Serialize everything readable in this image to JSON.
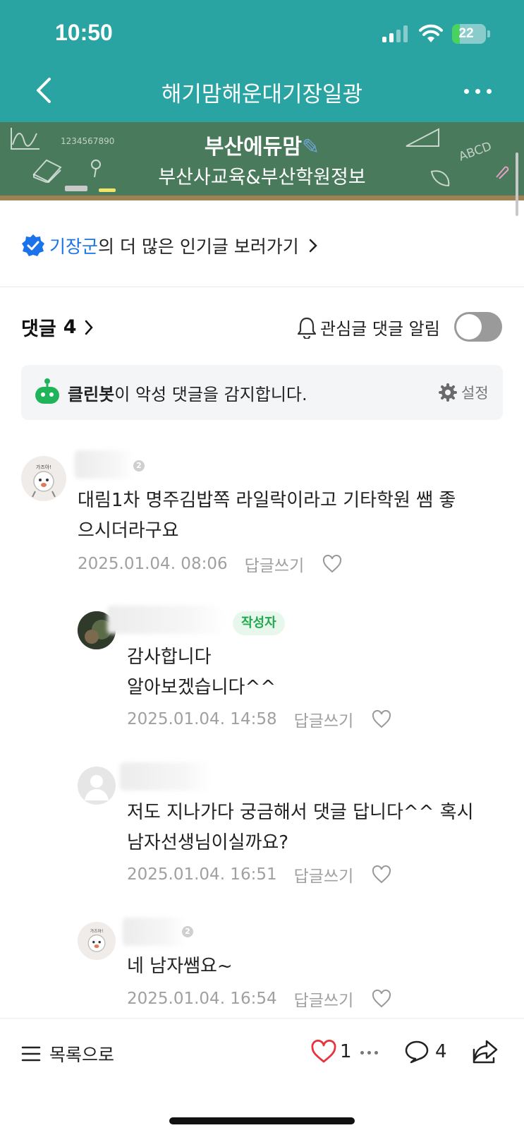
{
  "status_bar": {
    "time": "10:50",
    "battery": "22",
    "battery_level": 0.22
  },
  "nav": {
    "title": "해기맘해운대기장일광"
  },
  "banner": {
    "title": "부산에듀맘",
    "subtitle": "부산사교육&부산학원정보",
    "chalk_digits": "1234567890",
    "chalk_letters": "ABCD"
  },
  "popular": {
    "region": "기장군",
    "text": "의 더 많은 인기글 보러가기"
  },
  "comments_header": {
    "label": "댓글",
    "count": "4",
    "alarm_label": "관심글 댓글 알림",
    "alarm_on": false
  },
  "cleanbot": {
    "name": "클린봇",
    "message": "이 악성 댓글을 감지합니다.",
    "settings": "설정"
  },
  "comments": [
    {
      "text_line1": "대림1차 명주김밥쪽 라일락이라고 기타학원 쌤 좋",
      "text_line2": "으시더라구요",
      "time": "2025.01.04. 08:06",
      "reply": "답글쓰기",
      "level": "2"
    },
    {
      "badge": "작성자",
      "text_line1": "감사합니다",
      "text_line2": "알아보겠습니다^^",
      "time": "2025.01.04. 14:58",
      "reply": "답글쓰기"
    },
    {
      "text_line1": "저도 지나가다 궁금해서 댓글 답니다^^ 혹시",
      "text_line2": "남자선생님이실까요?",
      "time": "2025.01.04. 16:51",
      "reply": "답글쓰기"
    },
    {
      "text_line1": "네 남자쌤요~",
      "time": "2025.01.04. 16:54",
      "reply": "답글쓰기",
      "level": "2"
    }
  ],
  "bottom_bar": {
    "list_label": "목록으로",
    "like_count": "1",
    "comment_count": "4"
  },
  "colors": {
    "header": "#2aa3a3",
    "accent_blue": "#1a73e8",
    "author_green": "#1faa4c",
    "like_red": "#e8323c"
  }
}
